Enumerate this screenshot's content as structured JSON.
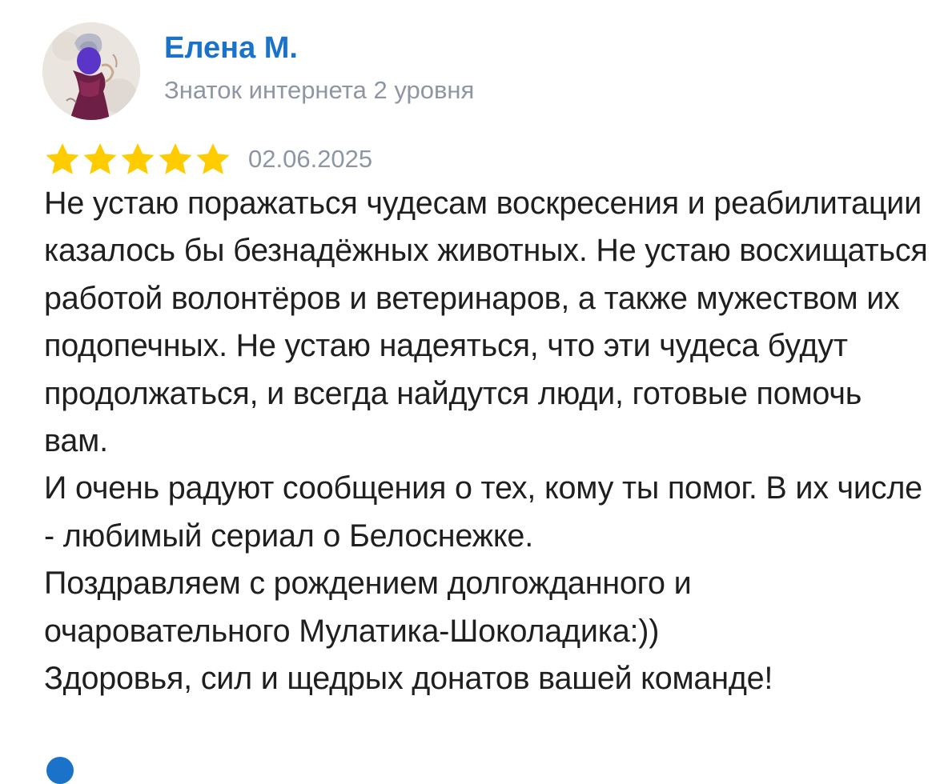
{
  "review": {
    "author": {
      "name": "Елена М.",
      "level": "Знаток интернета 2 уровня",
      "avatar_icon": "user-avatar"
    },
    "rating": 5,
    "rating_max": 5,
    "date": "02.06.2025",
    "text": {
      "paragraph_1": "Не устаю поражаться чудесам воскресения и реабилитации казалось бы безнадёжных животных. Не устаю восхищаться работой волонтёров и ветеринаров, а также мужеством их подопечных. Не устаю надеяться, что эти чудеса будут продолжаться, и всегда найдутся люди, готовые помочь вам.",
      "paragraph_2": "И очень радуют сообщения о тех, кому ты помог. В их числе - любимый сериал о Белоснежке.",
      "paragraph_3": "Поздравляем с рождением долгожданного и очаровательного Мулатика-Шоколадика:))",
      "paragraph_4": "Здоровья, сил и щедрых донатов вашей команде!"
    }
  },
  "colors": {
    "author_name": "#1a73c8",
    "muted_text": "#8f96a3",
    "star_fill": "#ffcc00",
    "body_text": "#1f1f1f"
  }
}
